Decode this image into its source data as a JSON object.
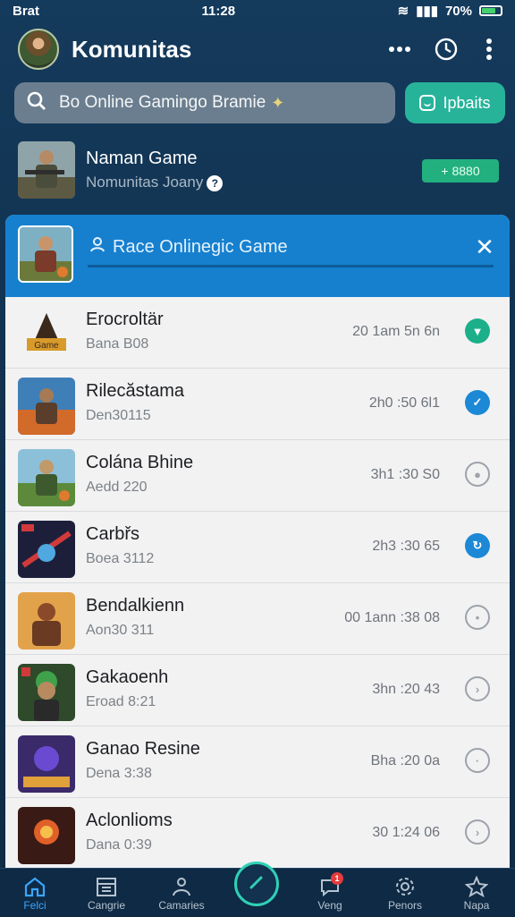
{
  "status_bar": {
    "left": "Brat",
    "time": "11:28",
    "battery": "70%"
  },
  "header": {
    "title": "Komunitas"
  },
  "search": {
    "text": "Bo Online Gamingo Bramie",
    "join_label": "Ipbaits"
  },
  "featured": {
    "title": "Naman Game",
    "subtitle": "Nomunitas Joany",
    "badge": "+ 8880"
  },
  "panel": {
    "title": "Race Onlinegic Game"
  },
  "items": [
    {
      "title": "Erocroltär",
      "sub": "Bana B08",
      "time": "20 1am 5n 6n",
      "status": "green"
    },
    {
      "title": "Rilecăstama",
      "sub": "Den30115",
      "time": "2h0 :50 6l1",
      "status": "blue"
    },
    {
      "title": "Colána Bhine",
      "sub": "Aedd 220",
      "time": "3h1 :30 S0",
      "status": "outline"
    },
    {
      "title": "Carbřs",
      "sub": "Boea 3112",
      "time": "2h3 :30 65",
      "status": "blue"
    },
    {
      "title": "Bendalkienn",
      "sub": "Aon30 311",
      "time": "00 1ann :38 08",
      "status": "outline"
    },
    {
      "title": "Gakaoenh",
      "sub": "Eroad 8:21",
      "time": "3hn :20 43",
      "status": "outline"
    },
    {
      "title": "Ganao Resine",
      "sub": "Dena 3:38",
      "time": "Bha :20 0a",
      "status": "outline"
    },
    {
      "title": "Aclonlioms",
      "sub": "Dana 0:39",
      "time": "30 1:24 06",
      "status": "outline"
    }
  ],
  "nav": [
    {
      "label": "Felci",
      "icon": "home-icon"
    },
    {
      "label": "Cangrie",
      "icon": "calendar-icon"
    },
    {
      "label": "Camaries",
      "icon": "people-icon"
    },
    {
      "label": "",
      "icon": "pencil-icon"
    },
    {
      "label": "Veng",
      "icon": "chat-icon",
      "badge": "1"
    },
    {
      "label": "Penors",
      "icon": "gear-icon"
    },
    {
      "label": "Napa",
      "icon": "star-icon"
    }
  ],
  "colors": {
    "accent": "#1680cf",
    "join": "#26b39a",
    "badge": "#22b07e"
  }
}
